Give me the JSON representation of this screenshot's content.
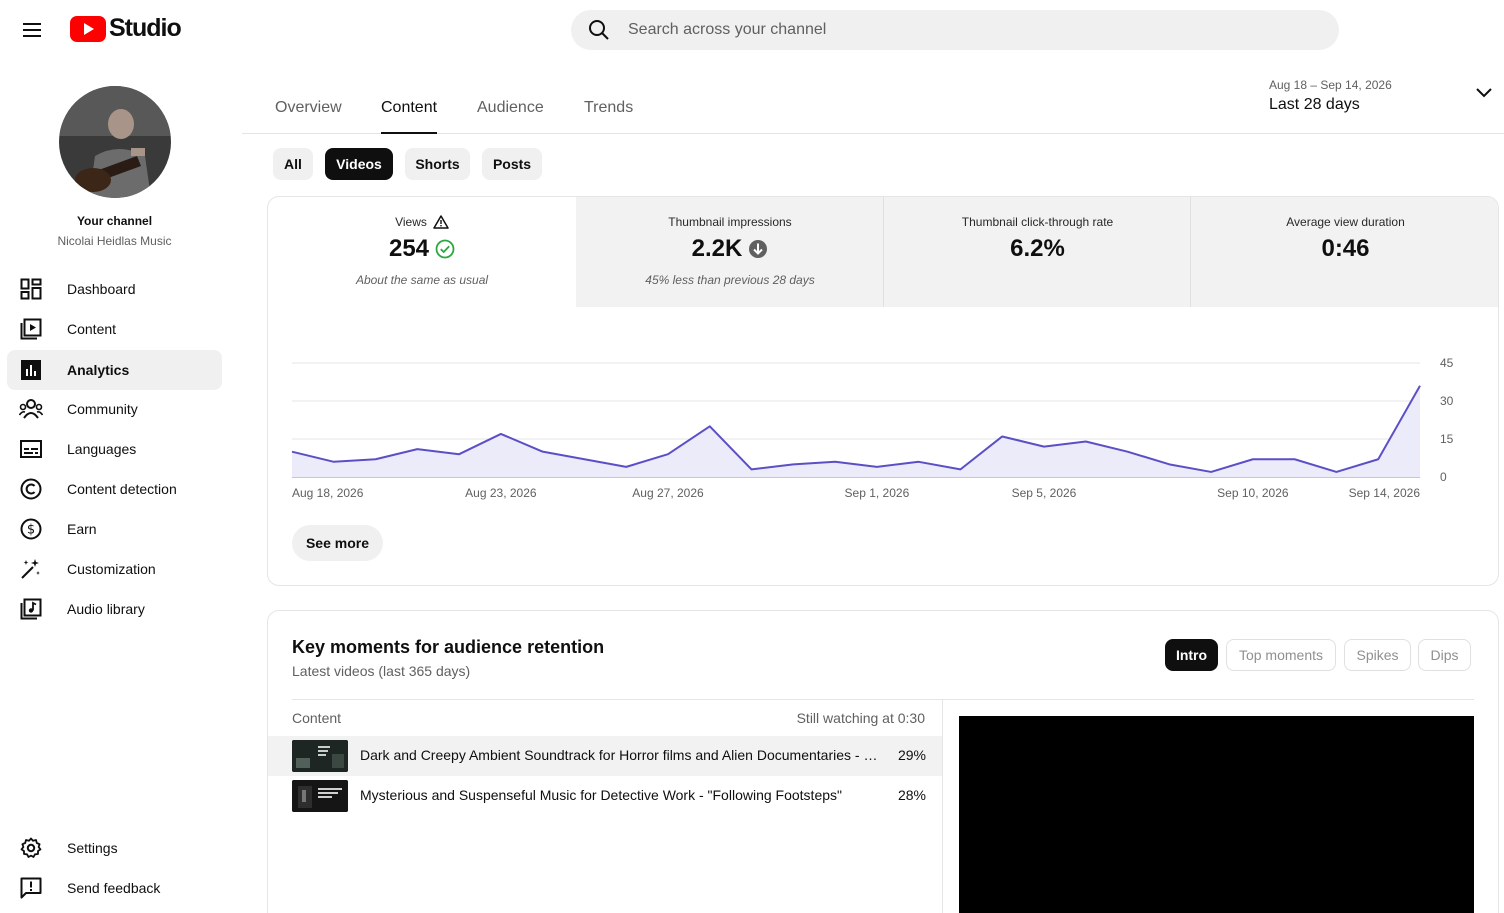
{
  "header": {
    "logo_text": "Studio",
    "search_placeholder": "Search across your channel",
    "brand_color": "#ff0000"
  },
  "sidebar": {
    "your_channel": "Your channel",
    "channel_name": "Nicolai Heidlas Music",
    "items": [
      {
        "label": "Dashboard",
        "icon": "dashboard-icon"
      },
      {
        "label": "Content",
        "icon": "content-icon"
      },
      {
        "label": "Analytics",
        "icon": "analytics-icon",
        "active": true
      },
      {
        "label": "Community",
        "icon": "community-icon"
      },
      {
        "label": "Languages",
        "icon": "languages-icon"
      },
      {
        "label": "Content detection",
        "icon": "copyright-icon"
      },
      {
        "label": "Earn",
        "icon": "dollar-icon"
      },
      {
        "label": "Customization",
        "icon": "magic-wand-icon"
      },
      {
        "label": "Audio library",
        "icon": "audio-library-icon"
      }
    ],
    "bottom_items": [
      {
        "label": "Settings",
        "icon": "gear-icon"
      },
      {
        "label": "Send feedback",
        "icon": "feedback-icon"
      }
    ]
  },
  "tabs": [
    "Overview",
    "Content",
    "Audience",
    "Trends"
  ],
  "active_tab": "Content",
  "date_range": {
    "sub": "Aug 18 – Sep 14, 2026",
    "main": "Last 28 days"
  },
  "chips": [
    "All",
    "Videos",
    "Shorts",
    "Posts"
  ],
  "active_chip": "Videos",
  "metrics": [
    {
      "label": "Views",
      "value": "254",
      "note": "About the same as usual",
      "status": "check",
      "warning": true
    },
    {
      "label": "Thumbnail impressions",
      "value": "2.2K",
      "note": "45% less than previous 28 days",
      "status": "down"
    },
    {
      "label": "Thumbnail click-through rate",
      "value": "6.2%",
      "note": ""
    },
    {
      "label": "Average view duration",
      "value": "0:46",
      "note": ""
    }
  ],
  "chart_data": {
    "type": "area",
    "title": "",
    "xlabel": "",
    "ylabel": "",
    "x": [
      "Aug 18",
      "Aug 19",
      "Aug 20",
      "Aug 21",
      "Aug 22",
      "Aug 23",
      "Aug 24",
      "Aug 25",
      "Aug 26",
      "Aug 27",
      "Aug 28",
      "Aug 29",
      "Aug 30",
      "Aug 31",
      "Sep 1",
      "Sep 2",
      "Sep 3",
      "Sep 4",
      "Sep 5",
      "Sep 6",
      "Sep 7",
      "Sep 8",
      "Sep 9",
      "Sep 10",
      "Sep 11",
      "Sep 12",
      "Sep 13",
      "Sep 14"
    ],
    "series": [
      {
        "values": [
          10,
          6,
          7,
          11,
          9,
          17,
          10,
          7,
          4,
          9,
          20,
          3,
          5,
          6,
          4,
          6,
          3,
          16,
          12,
          14,
          10,
          5,
          2,
          7,
          7,
          2,
          7,
          36
        ]
      }
    ],
    "x_tick_labels": [
      "Aug 18, 2026",
      "Aug 23, 2026",
      "Aug 27, 2026",
      "Sep 1, 2026",
      "Sep 5, 2026",
      "Sep 10, 2026",
      "Sep 14, 2026"
    ],
    "y_ticks": [
      0,
      15,
      30,
      45
    ],
    "ylim": [
      0,
      45
    ],
    "grid": true,
    "color": "#5b4fc6",
    "fill_color": "#ecebfa"
  },
  "see_more": "See more",
  "key_moments": {
    "title": "Key moments for audience retention",
    "subtitle": "Latest videos (last 365 days)",
    "chips": [
      "Intro",
      "Top moments",
      "Spikes",
      "Dips"
    ],
    "active_chip": "Intro",
    "col_content": "Content",
    "col_metric": "Still watching at 0:30",
    "rows": [
      {
        "title": "Dark and Creepy Ambient Soundtrack for Horror films and Alien Documentaries - \"...",
        "pct": "29%"
      },
      {
        "title": "Mysterious and Suspenseful Music for Detective Work - \"Following Footsteps\"",
        "pct": "28%"
      }
    ]
  }
}
